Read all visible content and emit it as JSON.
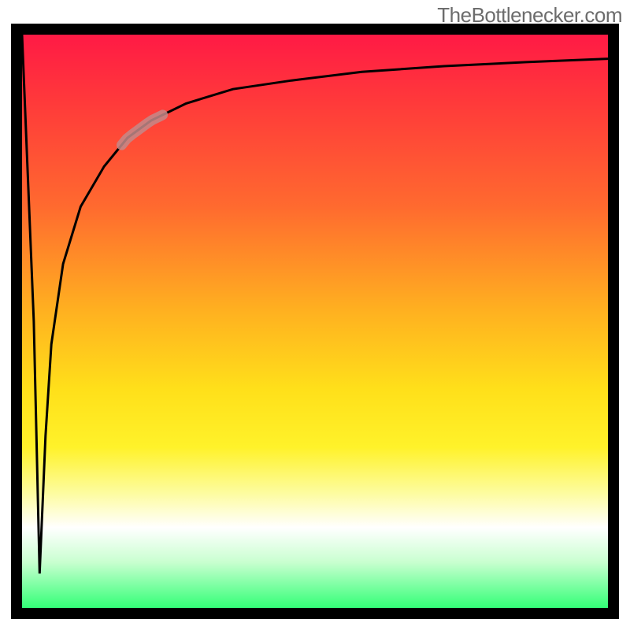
{
  "watermark": "TheBottlenecker.com",
  "chart_data": {
    "type": "line",
    "title": "",
    "xlabel": "",
    "ylabel": "",
    "xlim": [
      0,
      100
    ],
    "ylim": [
      0,
      100
    ],
    "series": [
      {
        "name": "bottleneck-curve",
        "x": [
          0,
          2,
          3,
          4,
          5,
          7,
          10,
          14,
          18,
          22,
          28,
          36,
          46,
          58,
          72,
          86,
          100
        ],
        "y": [
          100,
          50,
          6,
          30,
          46,
          60,
          70,
          77,
          82,
          85,
          88,
          90.5,
          92,
          93.5,
          94.5,
          95.2,
          95.8
        ]
      }
    ],
    "annotations": [
      {
        "name": "highlight-segment",
        "x_range_pct": [
          17,
          24
        ],
        "style": "wide-stroke"
      }
    ],
    "background_gradient": {
      "direction": "vertical",
      "stops": [
        {
          "pos": 0.0,
          "color": "#ff1a45"
        },
        {
          "pos": 0.3,
          "color": "#ff6a2f"
        },
        {
          "pos": 0.62,
          "color": "#ffe01a"
        },
        {
          "pos": 0.86,
          "color": "#ffffff"
        },
        {
          "pos": 1.0,
          "color": "#33ff77"
        }
      ]
    }
  }
}
